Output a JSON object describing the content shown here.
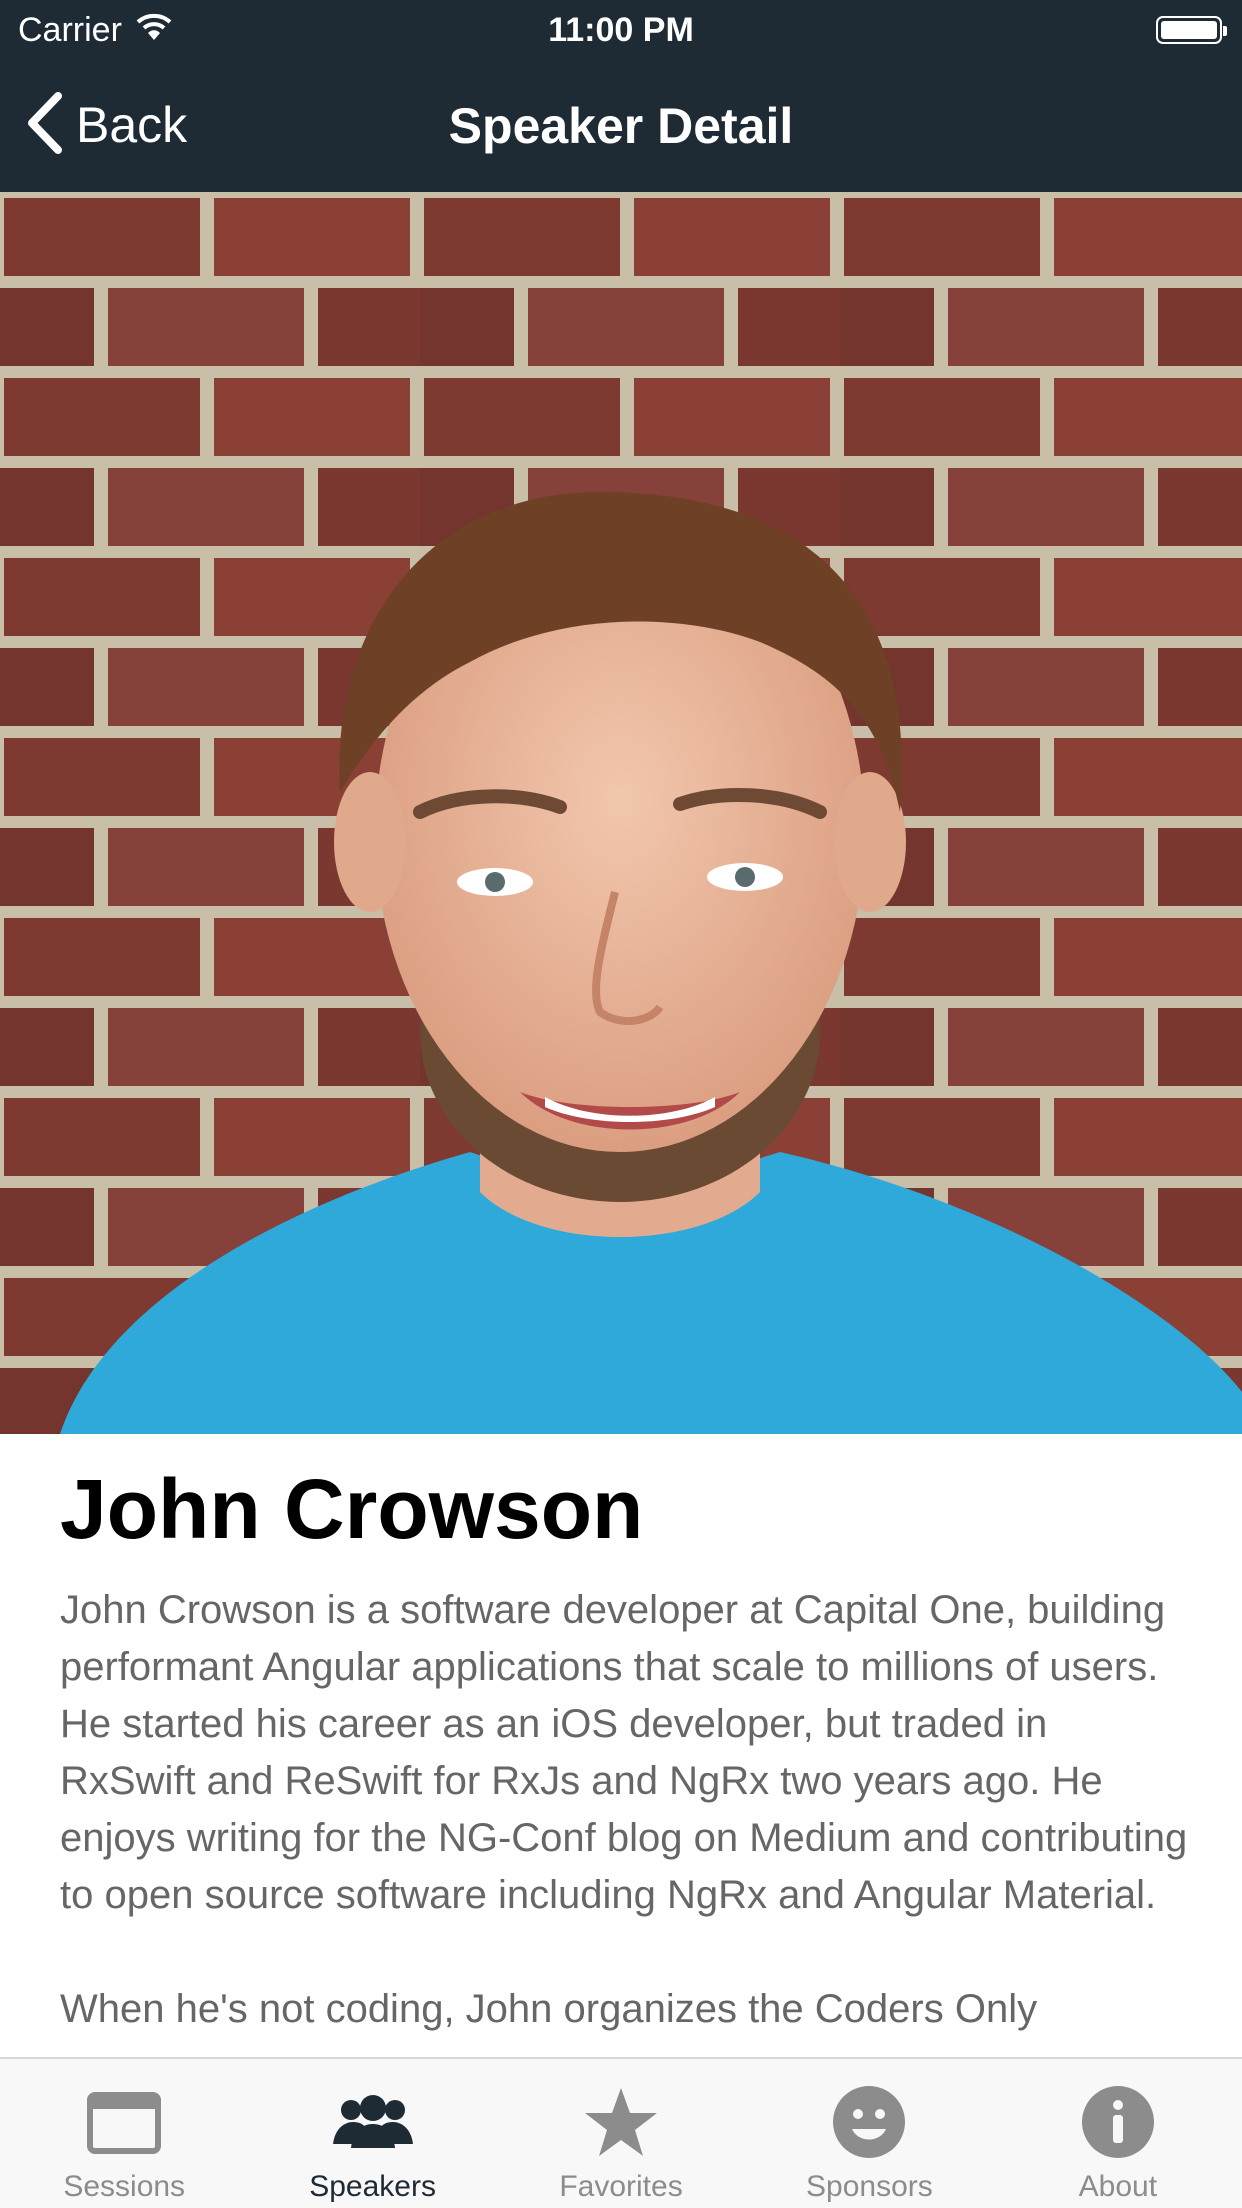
{
  "status_bar": {
    "carrier": "Carrier",
    "time": "11:00 PM",
    "wifi_icon": "wifi-icon",
    "battery_icon": "battery-icon"
  },
  "nav": {
    "back_label": "Back",
    "title": "Speaker Detail",
    "back_icon": "chevron-left-icon"
  },
  "speaker": {
    "name": "John Crowson",
    "bio_paragraphs": [
      "John Crowson is a software developer at Capital One, building performant Angular applications that scale to millions of users. He started his career as an iOS developer, but traded in RxSwift and ReSwift for RxJs and NgRx two years ago. He enjoys writing for the NG-Conf blog on Medium and contributing to open source software including NgRx and Angular Material.",
      "When he's not coding, John organizes the Coders Only"
    ]
  },
  "tabs": [
    {
      "label": "Sessions",
      "icon": "calendar-icon",
      "active": false
    },
    {
      "label": "Speakers",
      "icon": "people-icon",
      "active": true
    },
    {
      "label": "Favorites",
      "icon": "star-icon",
      "active": false
    },
    {
      "label": "Sponsors",
      "icon": "smiley-icon",
      "active": false
    },
    {
      "label": "About",
      "icon": "info-icon",
      "active": false
    }
  ],
  "colors": {
    "header_bg": "#1e2b35",
    "tab_active": "#1e2b35",
    "tab_inactive": "#8c8c8c",
    "bio_text": "#666666"
  }
}
